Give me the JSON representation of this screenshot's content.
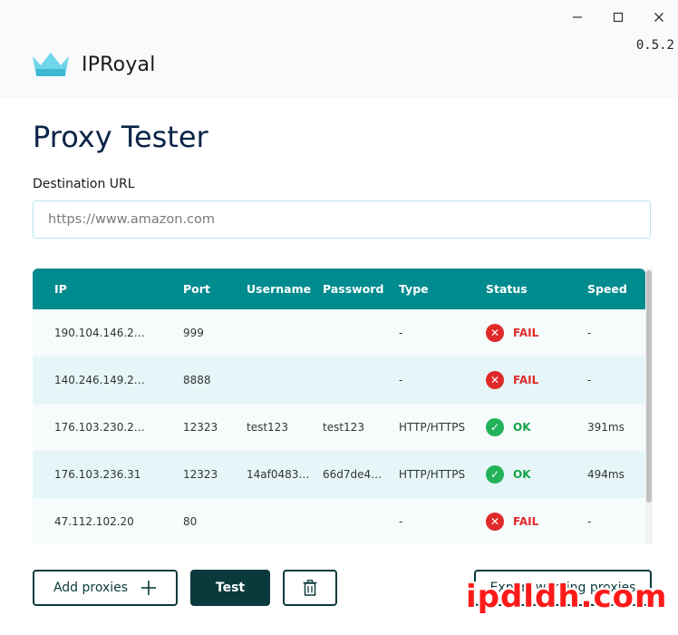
{
  "window": {
    "version": "0.5.2",
    "controls": {
      "minimize": "minimize",
      "maximize": "maximize",
      "close": "close"
    }
  },
  "brand": {
    "name": "IPRoyal",
    "logo_icon": "crown-icon",
    "logo_color": "#4fc9e0"
  },
  "page": {
    "title": "Proxy Tester"
  },
  "destination": {
    "label": "Destination URL",
    "value": "",
    "placeholder": "https://www.amazon.com"
  },
  "table": {
    "columns": [
      "IP",
      "Port",
      "Username",
      "Password",
      "Type",
      "Status",
      "Speed"
    ],
    "rows": [
      {
        "ip": "190.104.146.2…",
        "port": "999",
        "username": "",
        "password": "",
        "type": "-",
        "status": "FAIL",
        "speed": "-"
      },
      {
        "ip": "140.246.149.2…",
        "port": "8888",
        "username": "",
        "password": "",
        "type": "-",
        "status": "FAIL",
        "speed": "-"
      },
      {
        "ip": "176.103.230.2…",
        "port": "12323",
        "username": "test123",
        "password": "test123",
        "type": "HTTP/HTTPS",
        "status": "OK",
        "speed": "391ms"
      },
      {
        "ip": "176.103.236.31",
        "port": "12323",
        "username": "14af0483…",
        "password": "66d7de4…",
        "type": "HTTP/HTTPS",
        "status": "OK",
        "speed": "494ms"
      },
      {
        "ip": "47.112.102.20",
        "port": "80",
        "username": "",
        "password": "",
        "type": "-",
        "status": "FAIL",
        "speed": "-"
      }
    ]
  },
  "actions": {
    "add_label": "Add proxies",
    "test_label": "Test",
    "delete_icon": "trash-icon",
    "export_label": "Export working proxies"
  },
  "watermark": "ipdldh.com",
  "colors": {
    "header": "#008b8f",
    "title": "#0b2447",
    "button_dark": "#0b3a3c",
    "fail": "#e02a2a",
    "ok": "#22b35a"
  }
}
